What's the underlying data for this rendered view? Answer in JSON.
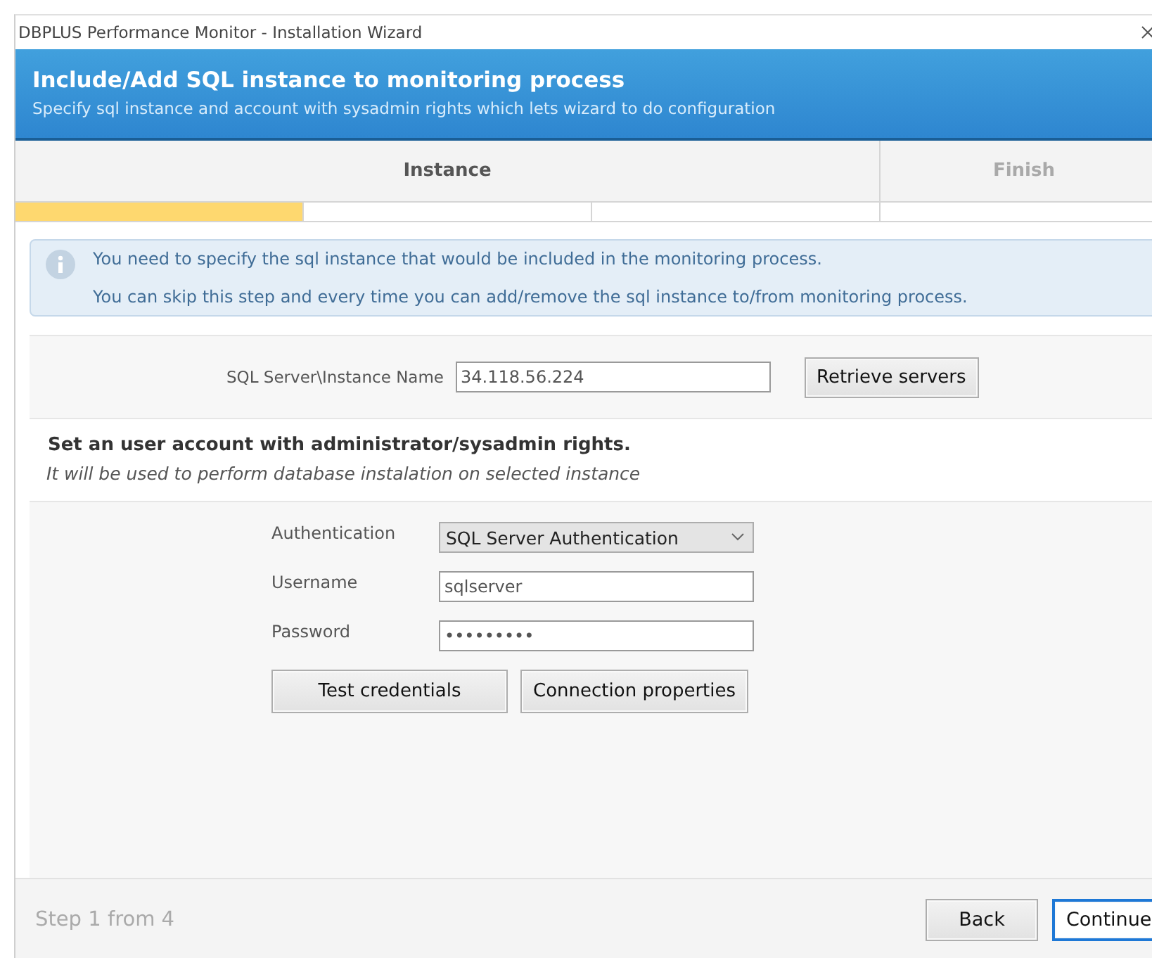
{
  "window": {
    "title": "DBPLUS Performance Monitor - Installation Wizard"
  },
  "header": {
    "title": "Include/Add SQL instance to monitoring process",
    "subtitle": "Specify sql instance and account with sysadmin rights which lets wizard to do configuration"
  },
  "steps": [
    {
      "label": "Instance",
      "selected": true
    },
    {
      "label": "Finish",
      "selected": false
    }
  ],
  "progress": [
    {
      "filled": true
    },
    {
      "filled": false
    },
    {
      "filled": false
    },
    {
      "filled": false
    }
  ],
  "info": {
    "lines": [
      "You need to specify the sql instance that would be included in the monitoring process.",
      "You can skip this step and every time you can add/remove the sql instance to/from monitoring process."
    ]
  },
  "instance": {
    "label": "SQL Server\\Instance Name",
    "value": "34.118.56.224",
    "button": "Retrieve servers"
  },
  "account": {
    "title": "Set an user account with administrator/sysadmin rights.",
    "note": "It will be used to perform database instalation on selected instance"
  },
  "form": [
    {
      "kind": "select",
      "label": "Authentication",
      "value": "SQL Server Authentication"
    },
    {
      "kind": "text",
      "label": "Username",
      "value": "sqlserver"
    },
    {
      "kind": "password",
      "label": "Password",
      "value": "•••••••••"
    }
  ],
  "form_buttons": [
    "Test credentials",
    "Connection properties"
  ],
  "footer": {
    "step": "Step 1 from 4",
    "buttons": [
      {
        "label": "Back",
        "selected": false
      },
      {
        "label": "Continue",
        "selected": true
      }
    ]
  }
}
